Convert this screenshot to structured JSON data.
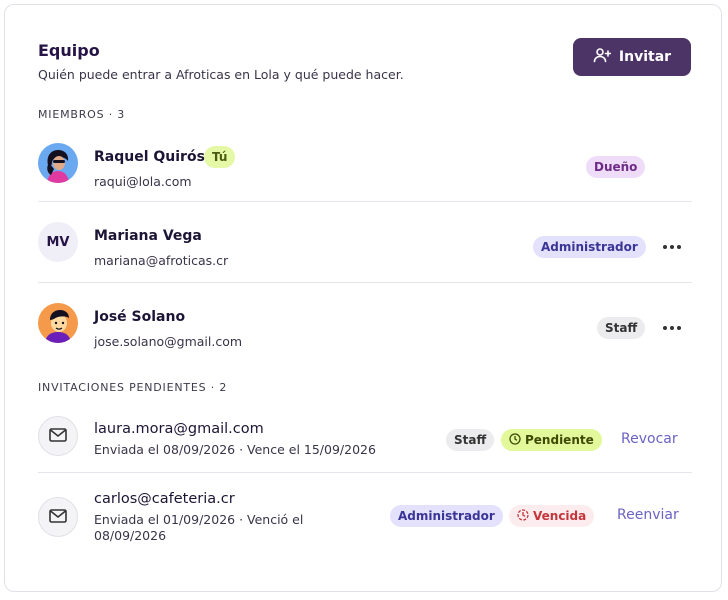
{
  "header": {
    "title": "Equipo",
    "subtitle": "Quién puede entrar a Afroticas en Lola y qué puede hacer.",
    "invite_label": "Invitar"
  },
  "members": {
    "section_label": "MIEMBROS · 3",
    "items": [
      {
        "name": "Raquel Quirós",
        "you_badge": "Tú",
        "email": "raqui@lola.com",
        "role": "Dueño"
      },
      {
        "name": "Mariana Vega",
        "initials": "MV",
        "email": "mariana@afroticas.cr",
        "role": "Administrador"
      },
      {
        "name": "José Solano",
        "email": "jose.solano@gmail.com",
        "role": "Staff"
      }
    ]
  },
  "invitations": {
    "section_label": "INVITACIONES PENDIENTES · 2",
    "items": [
      {
        "email": "laura.mora@gmail.com",
        "meta": "Enviada el 08/09/2026 · Vence el 15/09/2026",
        "role": "Staff",
        "status": "Pendiente",
        "action": "Revocar"
      },
      {
        "email": "carlos@cafeteria.cr",
        "meta": "Enviada el 01/09/2026 · Venció el 08/09/2026",
        "role": "Administrador",
        "status": "Vencida",
        "action": "Reenviar"
      }
    ]
  },
  "colors": {
    "primary": "#4d3467",
    "link": "#6a63c3",
    "pending": "#e3f89a",
    "expired": "#c4353b"
  },
  "icons": {
    "invite": "user-plus-icon",
    "more": "more-horizontal-icon",
    "invitation": "mail-icon",
    "pending": "clock-icon",
    "expired": "clock-alert-icon"
  }
}
